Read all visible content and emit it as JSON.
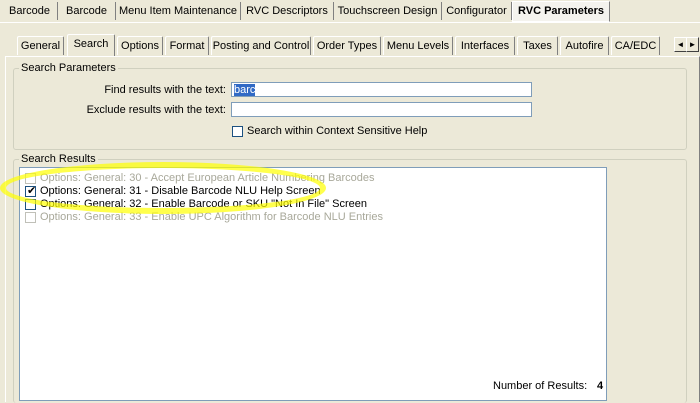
{
  "top_tabs": [
    {
      "label": "Barcode",
      "active": false
    },
    {
      "label": "Barcode",
      "active": false
    },
    {
      "label": "Menu Item Maintenance",
      "active": false
    },
    {
      "label": "RVC Descriptors",
      "active": false
    },
    {
      "label": "Touchscreen Design",
      "active": false
    },
    {
      "label": "Configurator",
      "active": false
    },
    {
      "label": "RVC Parameters",
      "active": true
    }
  ],
  "sub_tabs": [
    {
      "label": "General"
    },
    {
      "label": "Search"
    },
    {
      "label": "Options"
    },
    {
      "label": "Format"
    },
    {
      "label": "Posting and Control"
    },
    {
      "label": "Order Types"
    },
    {
      "label": "Menu Levels"
    },
    {
      "label": "Interfaces"
    },
    {
      "label": "Taxes"
    },
    {
      "label": "Autofire"
    },
    {
      "label": "CA/EDC"
    }
  ],
  "scroll_arrows": {
    "left": "◄",
    "right": "►"
  },
  "search_params": {
    "title": "Search Parameters",
    "find_label": "Find results with the text:",
    "find_value": "barc",
    "exclude_label": "Exclude results with the text:",
    "exclude_value": "",
    "context_label": "Search within Context Sensitive Help",
    "context_checked": false
  },
  "search_results": {
    "title": "Search Results",
    "items": [
      {
        "label": "Options: General: 30 - Accept European Article Numbering Barcodes",
        "checked": false,
        "enabled": false
      },
      {
        "label": "Options: General: 31 - Disable Barcode NLU Help Screen",
        "checked": true,
        "enabled": true
      },
      {
        "label": "Options: General: 32 - Enable Barcode or SKU \"Not In File\" Screen",
        "checked": false,
        "enabled": true
      },
      {
        "label": "Options: General: 33 - Enable UPC Algorithm for Barcode NLU Entries",
        "checked": false,
        "enabled": false
      }
    ],
    "count_label": "Number of Results:",
    "count_value": "4"
  },
  "colors": {
    "highlight": "#ffff00",
    "selection": "#316ac5"
  }
}
